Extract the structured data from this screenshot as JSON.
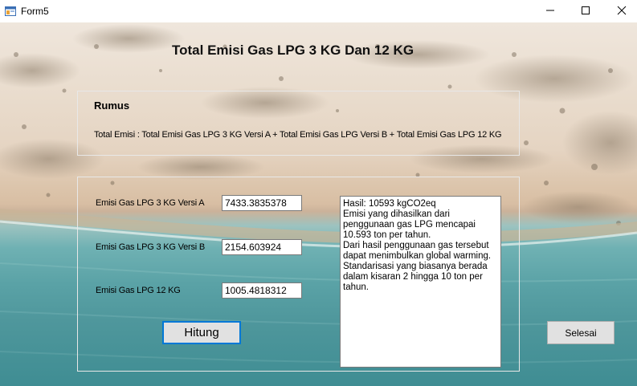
{
  "window": {
    "title": "Form5",
    "minimize_symbol": "—",
    "maximize_symbol": "☐",
    "close_symbol": "✕"
  },
  "heading": "Total Emisi Gas LPG 3 KG Dan 12 KG",
  "rumus": {
    "title": "Rumus",
    "formula": "Total Emisi  :  Total Emisi Gas LPG 3 KG Versi A + Total Emisi Gas LPG Versi B + Total Emisi Gas LPG 12 KG"
  },
  "fields": [
    {
      "label": "Emisi Gas LPG 3 KG Versi A",
      "value": "7433.3835378"
    },
    {
      "label": "Emisi Gas LPG 3 KG Versi B",
      "value": "2154.603924"
    },
    {
      "label": "Emisi Gas LPG 12 KG",
      "value": "1005.4818312"
    }
  ],
  "result_text": "Hasil: 10593 kgCO2eq\nEmisi yang dihasilkan dari penggunaan gas LPG mencapai 10.593 ton per tahun.\nDari hasil penggunaan gas tersebut dapat menimbulkan global warming.\nStandarisasi yang biasanya berada dalam kisaran 2 hingga 10 ton per tahun.",
  "buttons": {
    "hitung": "Hitung",
    "selesai": "Selesai"
  },
  "icons": {
    "app": "windows-form-icon",
    "minimize": "minimize-icon",
    "maximize": "maximize-icon",
    "close": "close-icon"
  }
}
